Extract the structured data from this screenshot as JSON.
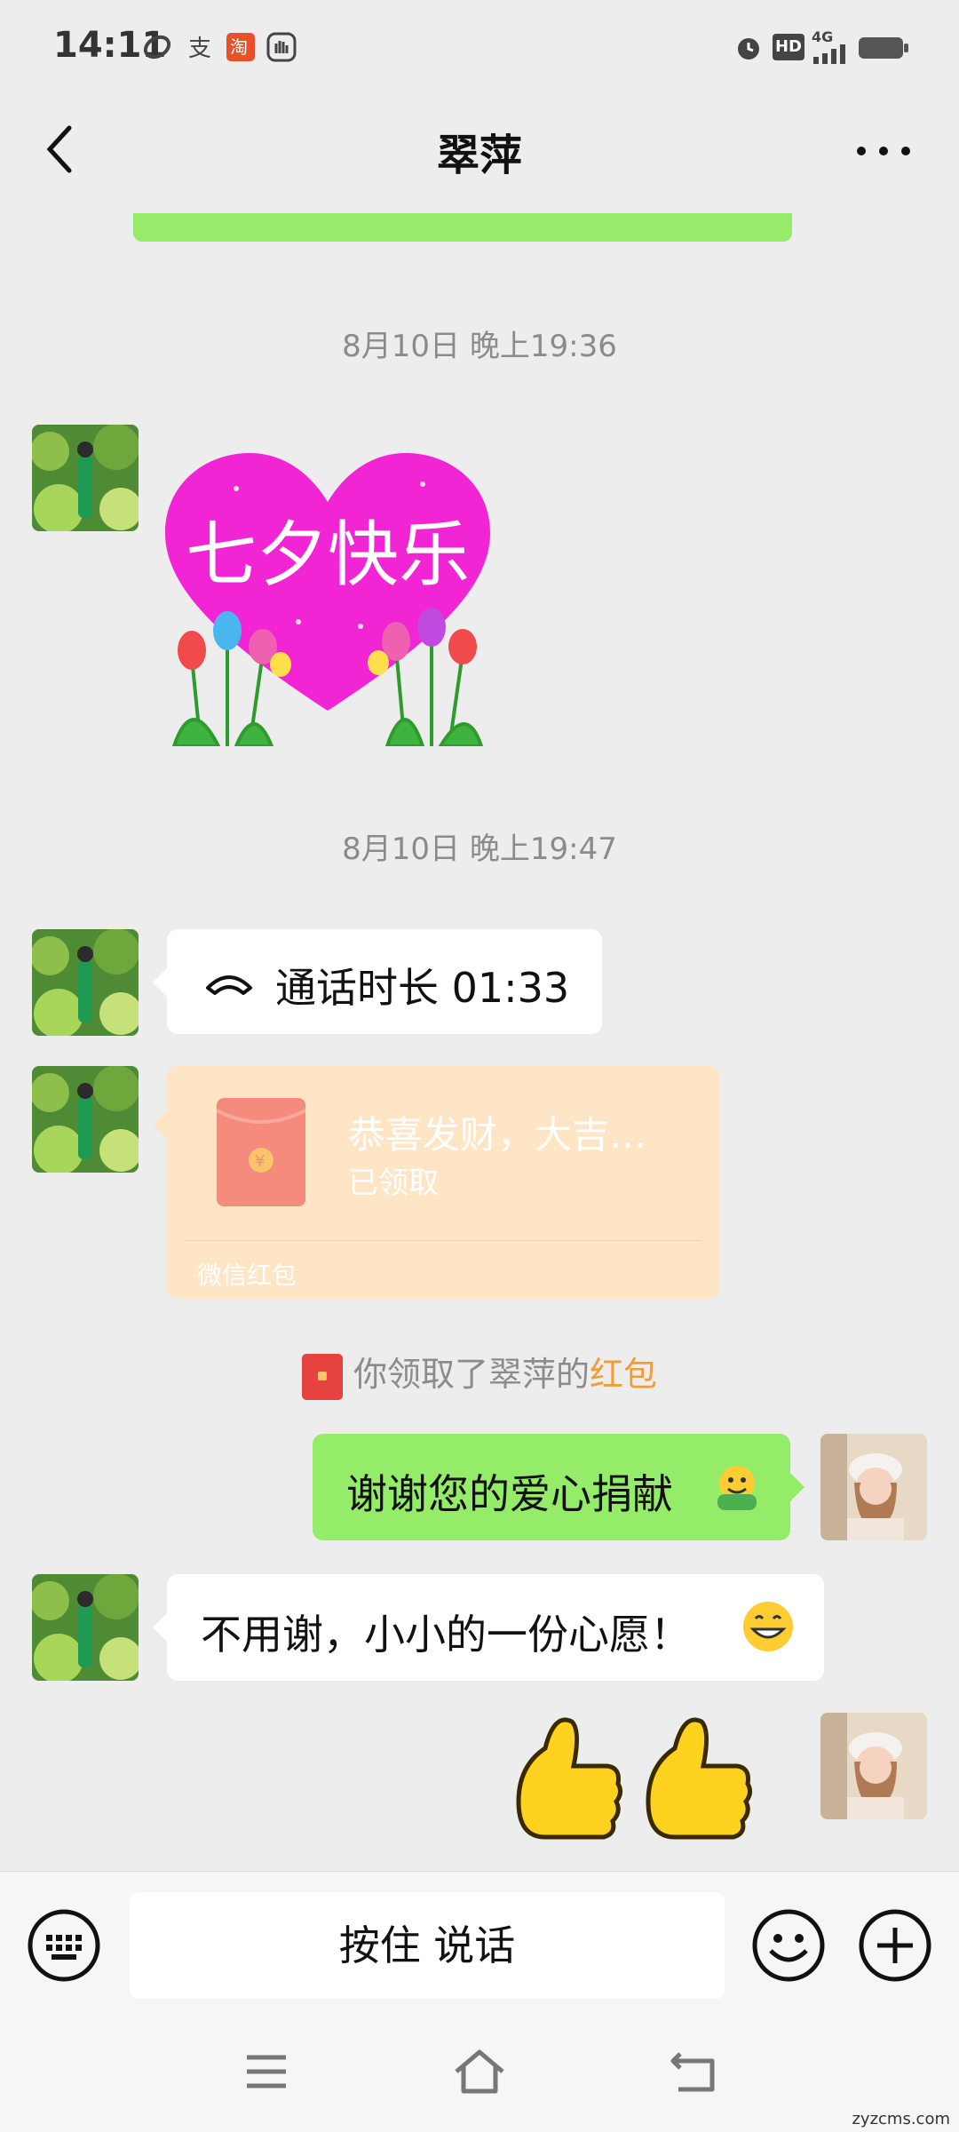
{
  "status_bar": {
    "time": "14:11",
    "left_icons": [
      "swirl-app-icon",
      "alipay-icon",
      "taobao-icon",
      "hand-icon"
    ],
    "right_icons": [
      "alarm-icon",
      "hd-icon",
      "signal-4g-icon",
      "battery-icon"
    ],
    "network": "4G",
    "hd": "HD"
  },
  "header": {
    "title": "翠萍",
    "back_icon": "back-chevron-icon",
    "more_icon": "more-dots-icon"
  },
  "messages": {
    "ts1": "8月10日 晚上19:36",
    "sticker1_text": "七夕快乐",
    "ts2": "8月10日 晚上19:47",
    "call_text": "通话时长 01:33",
    "redpacket": {
      "title": "恭喜发财，大吉…",
      "status": "已领取",
      "footer": "微信红包"
    },
    "system_notice_prefix": "你领取了翠萍的",
    "system_notice_link": "红包",
    "msg_out_1": "谢谢您的爱心捐献",
    "msg_in_1": "不用谢，小小的一份心愿！"
  },
  "input_bar": {
    "talk_label": "按住 说话",
    "keyboard_icon": "keyboard-icon",
    "emoji_icon": "emoji-icon",
    "plus_icon": "plus-icon"
  },
  "nav_bar": {
    "icons": [
      "menu-icon",
      "home-icon",
      "back-icon"
    ]
  },
  "watermark": "zyzcms.com",
  "colors": {
    "background": "#ededed",
    "green_bubble": "#95ec69",
    "redpacket_bg": "#fde5c6",
    "link_orange": "#f29c38"
  }
}
